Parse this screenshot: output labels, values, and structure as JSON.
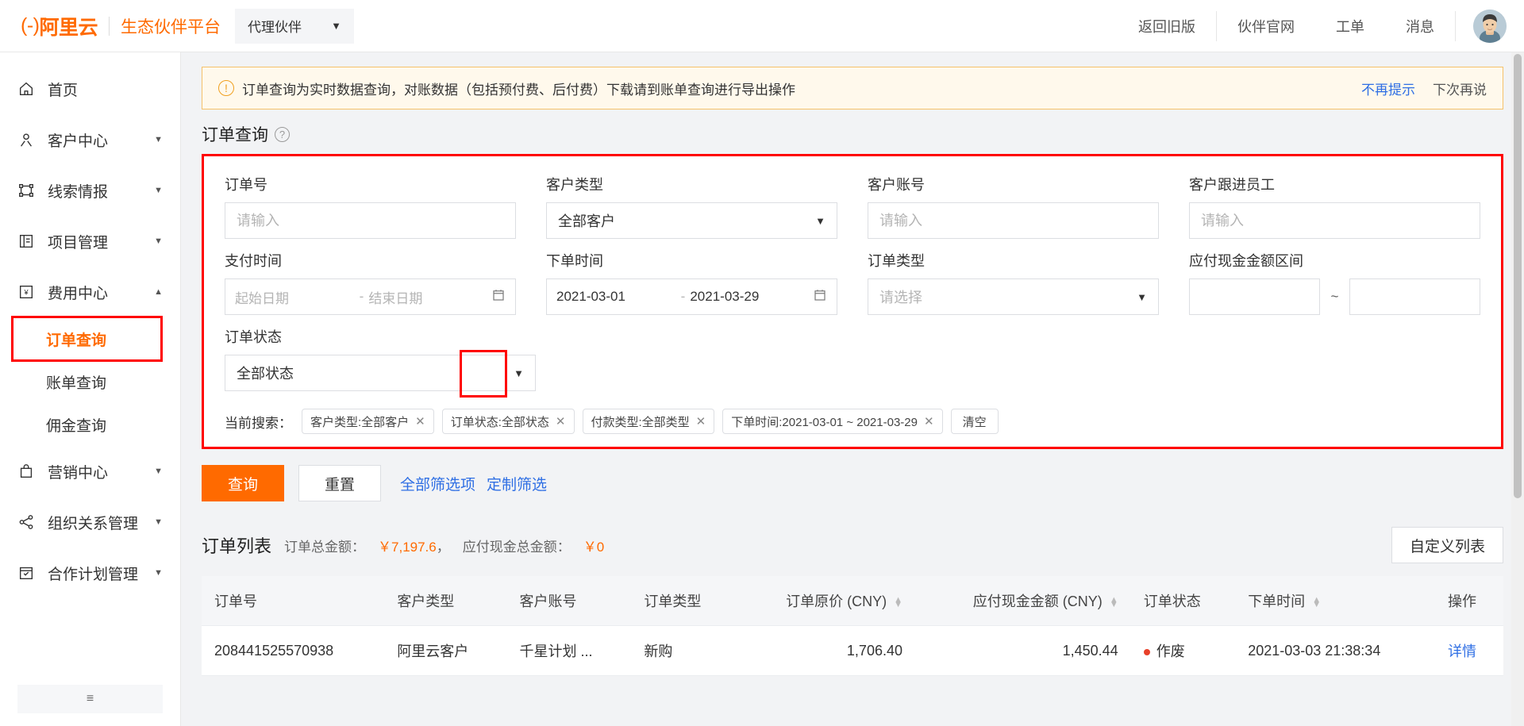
{
  "header": {
    "logo_text": "阿里云",
    "logo_bracket": "(-)",
    "brand_sub": "生态伙伴平台",
    "role_selected": "代理伙伴",
    "right_items": [
      {
        "label": "返回旧版"
      },
      {
        "label": "伙伴官网"
      },
      {
        "label": "工单"
      },
      {
        "label": "消息"
      }
    ],
    "avatar_name": "user-avatar"
  },
  "sidebar": {
    "items": [
      {
        "label": "首页",
        "icon": "home-icon",
        "expandable": false,
        "expanded": false
      },
      {
        "label": "客户中心",
        "icon": "customer-icon",
        "expandable": true,
        "expanded": false
      },
      {
        "label": "线索情报",
        "icon": "lead-icon",
        "expandable": true,
        "expanded": false
      },
      {
        "label": "项目管理",
        "icon": "project-icon",
        "expandable": true,
        "expanded": false
      },
      {
        "label": "费用中心",
        "icon": "fee-icon",
        "expandable": true,
        "expanded": true
      }
    ],
    "fee_children": [
      {
        "label": "订单查询",
        "active": true
      },
      {
        "label": "账单查询",
        "active": false
      },
      {
        "label": "佣金查询",
        "active": false
      }
    ],
    "items_after": [
      {
        "label": "营销中心",
        "icon": "marketing-icon",
        "expandable": true,
        "expanded": false
      },
      {
        "label": "组织关系管理",
        "icon": "org-icon",
        "expandable": true,
        "expanded": false
      },
      {
        "label": "合作计划管理",
        "icon": "plan-icon",
        "expandable": true,
        "expanded": false
      }
    ],
    "collapse_label": "≡"
  },
  "alert": {
    "text": "订单查询为实时数据查询，对账数据（包括预付费、后付费）下载请到账单查询进行导出操作",
    "link_primary": "不再提示",
    "link_secondary": "下次再说"
  },
  "page": {
    "title": "订单查询",
    "help_icon": "question-icon"
  },
  "filters": {
    "order_no": {
      "label": "订单号",
      "value": "",
      "placeholder": "请输入"
    },
    "customer_type": {
      "label": "客户类型",
      "value": "全部客户"
    },
    "customer_account": {
      "label": "客户账号",
      "value": "",
      "placeholder": "请输入"
    },
    "customer_staff": {
      "label": "客户跟进员工",
      "value": "",
      "placeholder": "请输入"
    },
    "pay_time": {
      "label": "支付时间",
      "start_placeholder": "起始日期",
      "end_placeholder": "结束日期",
      "start": "",
      "end": "",
      "separator": "-"
    },
    "order_time": {
      "label": "下单时间",
      "start": "2021-03-01",
      "end": "2021-03-29",
      "separator": "-"
    },
    "order_type": {
      "label": "订单类型",
      "value": "",
      "placeholder": "请选择"
    },
    "cash_range": {
      "label": "应付现金金额区间",
      "min": "",
      "max": "",
      "separator": "~",
      "min_placeholder": "",
      "max_placeholder": ""
    },
    "order_status": {
      "label": "订单状态",
      "value": "全部状态"
    }
  },
  "current_search": {
    "label": "当前搜索：",
    "tags": [
      {
        "text": "客户类型:全部客户",
        "close": "✕"
      },
      {
        "text": "订单状态:全部状态",
        "close": "✕"
      },
      {
        "text": "付款类型:全部类型",
        "close": "✕"
      },
      {
        "text": "下单时间:2021-03-01 ~ 2021-03-29",
        "close": "✕"
      }
    ],
    "clear_label": "清空"
  },
  "actions": {
    "query": "查询",
    "reset": "重置",
    "all_filters": "全部筛选项",
    "custom_filter": "定制筛选"
  },
  "order_list": {
    "title": "订单列表",
    "total_label": "订单总金额：",
    "total_value": "￥7,197.6",
    "total_sep": "，",
    "cash_label": "应付现金总金额：",
    "cash_value": "￥0",
    "custom_columns_btn": "自定义列表",
    "columns": [
      {
        "key": "order_no",
        "label": "订单号",
        "align": "left",
        "sortable": false
      },
      {
        "key": "customer_type",
        "label": "客户类型",
        "align": "left",
        "sortable": false
      },
      {
        "key": "customer_account",
        "label": "客户账号",
        "align": "left",
        "sortable": false
      },
      {
        "key": "order_type",
        "label": "订单类型",
        "align": "left",
        "sortable": false
      },
      {
        "key": "original_price",
        "label": "订单原价 (CNY)",
        "align": "right",
        "sortable": true
      },
      {
        "key": "cash_amount",
        "label": "应付现金金额 (CNY)",
        "align": "right",
        "sortable": true
      },
      {
        "key": "status",
        "label": "订单状态",
        "align": "left",
        "sortable": false
      },
      {
        "key": "order_time",
        "label": "下单时间",
        "align": "left",
        "sortable": true
      },
      {
        "key": "ops",
        "label": "操作",
        "align": "left",
        "sortable": false
      }
    ],
    "rows": [
      {
        "order_no": "208441525570938",
        "customer_type": "阿里云客户",
        "customer_account": "千星计划 ...",
        "order_type": "新购",
        "original_price": "1,706.40",
        "cash_amount": "1,450.44",
        "status": "作废",
        "status_color": "#e8402a",
        "order_time": "2021-03-03 21:38:34",
        "ops": "详情"
      }
    ]
  },
  "colors": {
    "brand_orange": "#ff6a00",
    "link_blue": "#2f6fe4",
    "highlight_red": "#ff0000",
    "status_red": "#e8402a"
  }
}
